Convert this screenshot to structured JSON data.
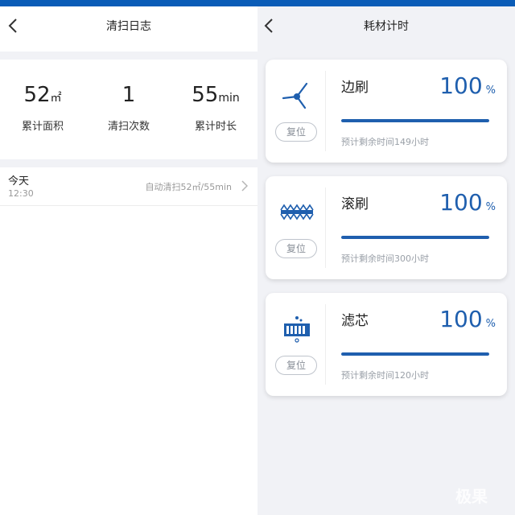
{
  "left": {
    "header": {
      "title": "清扫日志"
    },
    "stats": [
      {
        "value": "52",
        "unit": "㎡",
        "label": "累计面积"
      },
      {
        "value": "1",
        "unit": "",
        "label": "清扫次数"
      },
      {
        "value": "55",
        "unit": "min",
        "label": "累计时长"
      }
    ],
    "logs": [
      {
        "day": "今天",
        "time": "12:30",
        "summary": "自动清扫52㎡/55min"
      }
    ]
  },
  "right": {
    "header": {
      "title": "耗材计时"
    },
    "consumables": [
      {
        "name": "边刷",
        "percent": "100",
        "percent_symbol": "%",
        "progress": 1.0,
        "remaining": "预计剩余时间149小时",
        "reset_label": "复位",
        "icon": "side-brush-icon"
      },
      {
        "name": "滚刷",
        "percent": "100",
        "percent_symbol": "%",
        "progress": 1.0,
        "remaining": "预计剩余时间300小时",
        "reset_label": "复位",
        "icon": "roller-brush-icon"
      },
      {
        "name": "滤芯",
        "percent": "100",
        "percent_symbol": "%",
        "progress": 1.0,
        "remaining": "预计剩余时间120小时",
        "reset_label": "复位",
        "icon": "filter-icon"
      }
    ]
  },
  "watermark": "极果",
  "colors": {
    "accent": "#1f5fae",
    "topbar": "#0a5cb7",
    "panel_bg": "#f1f2f6"
  }
}
